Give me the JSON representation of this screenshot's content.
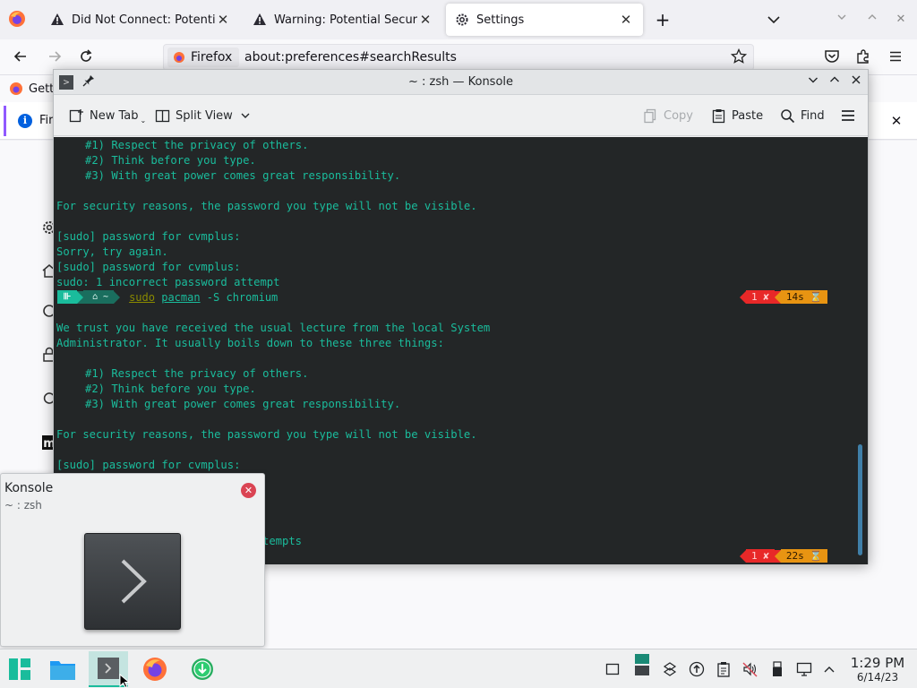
{
  "firefox": {
    "tabs": [
      {
        "title": "Did Not Connect: Potential",
        "icon": "warning-icon",
        "active": false
      },
      {
        "title": "Warning: Potential Security",
        "icon": "warning-icon",
        "active": false
      },
      {
        "title": "Settings",
        "icon": "gear-icon",
        "active": true
      }
    ],
    "identity_label": "Firefox",
    "url": "about:preferences#searchResults",
    "bookmark_label": "Gett",
    "notice_text": "Fir"
  },
  "konsole": {
    "title": "~ : zsh — Konsole",
    "toolbar": {
      "new_tab": "New Tab",
      "split_view": "Split View",
      "copy": "Copy",
      "paste": "Paste",
      "find": "Find"
    },
    "terminal": {
      "top_lines": [
        {
          "text": "#1) Respect the privacy of others.",
          "indent": true
        },
        {
          "text": "#2) Think before you type.",
          "indent": true
        },
        {
          "text": "#3) With great power comes great responsibility.",
          "indent": true
        },
        {
          "text": "",
          "indent": false
        },
        {
          "text": "For security reasons, the password you type will not be visible.",
          "indent": false
        },
        {
          "text": "",
          "indent": false
        },
        {
          "text": "[sudo] password for cvmplus:",
          "indent": false
        },
        {
          "text": "Sorry, try again.",
          "indent": false
        },
        {
          "text": "[sudo] password for cvmplus:",
          "indent": false
        },
        {
          "text": "sudo: 1 incorrect password attempt",
          "indent": false
        }
      ],
      "prompt1": {
        "dir": "~",
        "cmd_sudo": "sudo",
        "cmd_pacman": "pacman",
        "cmd_rest": " -S chromium",
        "status_err": "1 ✘",
        "status_time": "14s ⌛"
      },
      "bottom_lines": [
        {
          "text": "",
          "indent": false
        },
        {
          "text": "We trust you have received the usual lecture from the local System",
          "indent": false
        },
        {
          "text": "Administrator. It usually boils down to these three things:",
          "indent": false
        },
        {
          "text": "",
          "indent": false
        },
        {
          "text": "#1) Respect the privacy of others.",
          "indent": true
        },
        {
          "text": "#2) Think before you type.",
          "indent": true
        },
        {
          "text": "#3) With great power comes great responsibility.",
          "indent": true
        },
        {
          "text": "",
          "indent": false
        },
        {
          "text": "For security reasons, the password you type will not be visible.",
          "indent": false
        },
        {
          "text": "",
          "indent": false
        },
        {
          "text": "[sudo] password for cvmplus:",
          "indent": false
        }
      ],
      "partial_line": "tempts",
      "prompt2": {
        "status_err": "1 ✘",
        "status_time": "22s ⌛"
      }
    }
  },
  "preview": {
    "title": "Konsole",
    "subtitle": "~ : zsh"
  },
  "clock": {
    "time": "1:29 PM",
    "date": "6/14/23"
  },
  "colors": {
    "terminal_bg": "#232627",
    "terminal_fg": "#1abc9c",
    "status_error": "#e82828",
    "status_duration": "#e89412",
    "manjaro_green": "#1abc9c"
  }
}
